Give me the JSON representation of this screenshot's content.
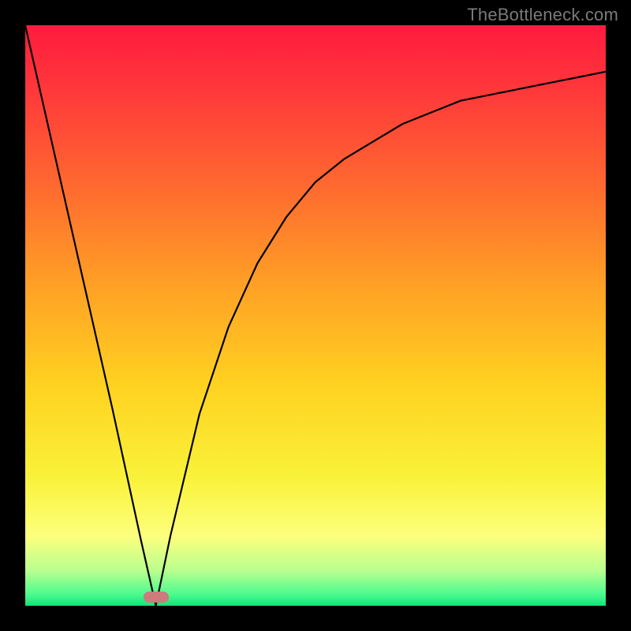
{
  "watermark": "TheBottleneck.com",
  "gradient": {
    "stops": [
      {
        "offset": "0%",
        "color": "#ff1b3f"
      },
      {
        "offset": "12%",
        "color": "#ff3a3a"
      },
      {
        "offset": "28%",
        "color": "#ff6a2f"
      },
      {
        "offset": "45%",
        "color": "#ffa125"
      },
      {
        "offset": "62%",
        "color": "#ffd220"
      },
      {
        "offset": "78%",
        "color": "#f9f23a"
      },
      {
        "offset": "88%",
        "color": "#fdff7d"
      },
      {
        "offset": "94%",
        "color": "#b8ff8f"
      },
      {
        "offset": "98%",
        "color": "#4dfb8e"
      },
      {
        "offset": "100%",
        "color": "#12e37a"
      }
    ]
  },
  "marker": {
    "x_frac": 0.225,
    "y_frac": 0.985,
    "color": "#cf7a7c"
  },
  "chart_data": {
    "type": "line",
    "title": "",
    "xlabel": "",
    "ylabel": "",
    "xlim": [
      0,
      1
    ],
    "ylim": [
      0,
      1
    ],
    "x": [
      0.0,
      0.05,
      0.1,
      0.15,
      0.2,
      0.225,
      0.25,
      0.3,
      0.35,
      0.4,
      0.45,
      0.5,
      0.55,
      0.6,
      0.65,
      0.7,
      0.75,
      0.8,
      0.85,
      0.9,
      0.95,
      1.0
    ],
    "values": [
      1.0,
      0.78,
      0.56,
      0.34,
      0.11,
      0.0,
      0.12,
      0.33,
      0.48,
      0.59,
      0.67,
      0.73,
      0.77,
      0.8,
      0.83,
      0.85,
      0.87,
      0.88,
      0.89,
      0.9,
      0.91,
      0.92
    ],
    "annotations": [
      {
        "text": "marker",
        "x": 0.225,
        "y": 0.015
      }
    ],
    "notes": "y is normalized 0..1 from bottom; curve is a sharp V reaching 0 near x≈0.225 then asymptotically rising toward ~0.92 at x=1. Background is a vertical gradient red→yellow→green (top→bottom)."
  }
}
